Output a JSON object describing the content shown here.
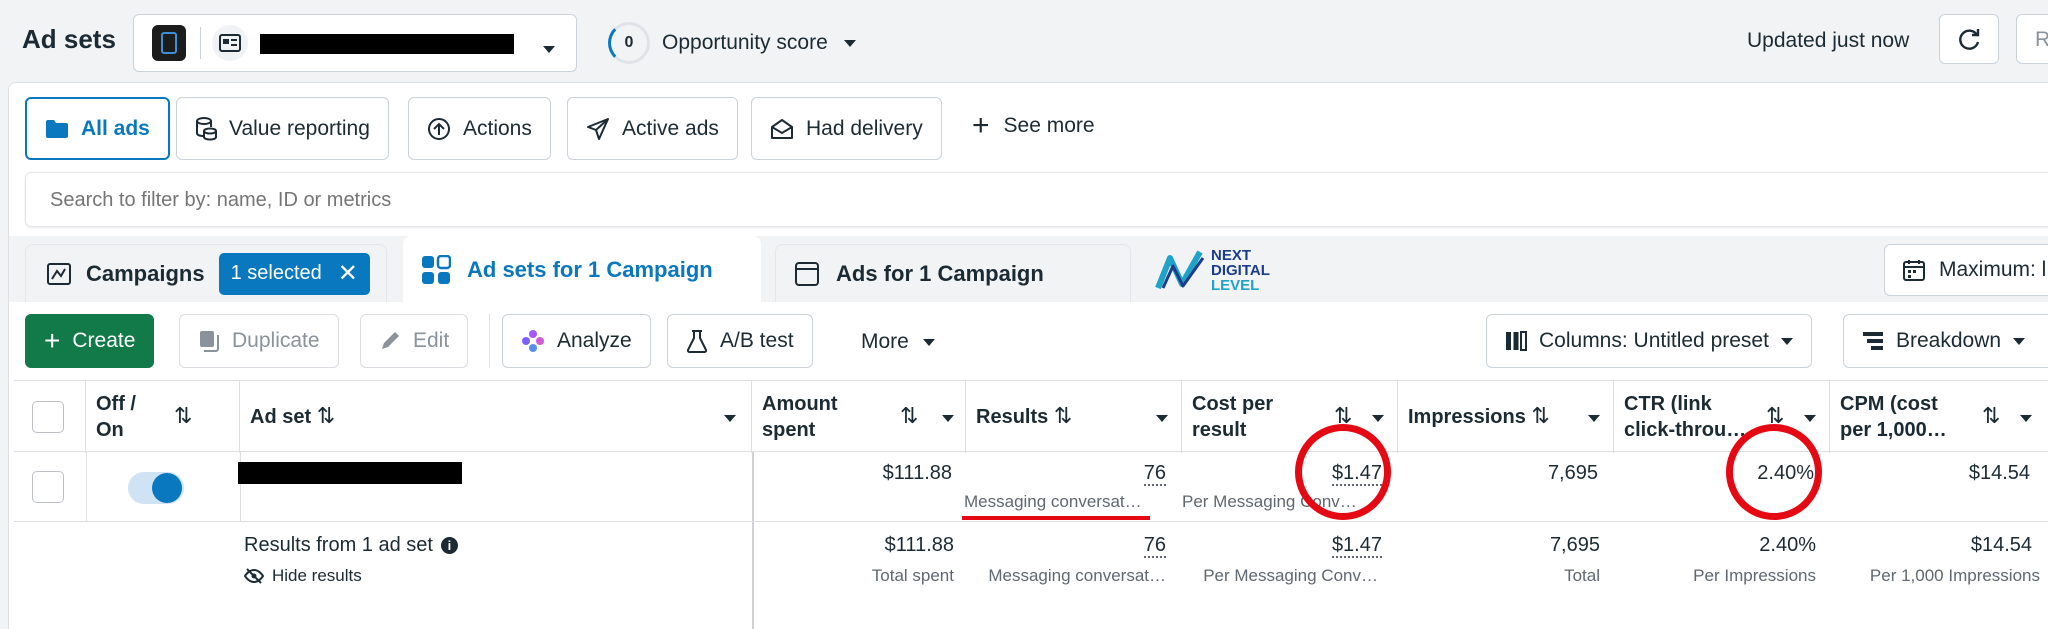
{
  "header": {
    "title": "Ad sets",
    "opportunity_score_value": "0",
    "opportunity_score_label": "Opportunity score",
    "updated_text": "Updated just now",
    "cut_button_label": "R"
  },
  "filters": {
    "all_ads": "All ads",
    "value_reporting": "Value reporting",
    "actions": "Actions",
    "active_ads": "Active ads",
    "had_delivery": "Had delivery",
    "see_more": "See more"
  },
  "search": {
    "placeholder": "Search to filter by: name, ID or metrics"
  },
  "tabs": {
    "campaigns": "Campaigns",
    "selected_badge": "1 selected",
    "ad_sets": "Ad sets for 1 Campaign",
    "ads": "Ads for 1 Campaign",
    "maximum_label": "Maximum: l"
  },
  "logo": {
    "line1": "NEXT",
    "line2": "DIGITAL",
    "line3": "LEVEL"
  },
  "toolbar": {
    "create": "Create",
    "duplicate": "Duplicate",
    "edit": "Edit",
    "analyze": "Analyze",
    "ab_test": "A/B test",
    "more": "More",
    "columns": "Columns: Untitled preset",
    "breakdown": "Breakdown"
  },
  "columns": {
    "off_on": "Off / On",
    "ad_set": "Ad set",
    "amount_spent": "Amount spent",
    "results": "Results",
    "cost_per_result": "Cost per result",
    "impressions": "Impressions",
    "ctr": "CTR (link click-throu…",
    "cpm": "CPM (cost per 1,000…"
  },
  "row": {
    "amount_spent": "$111.88",
    "results": "76",
    "results_sub": "Messaging conversat…",
    "cost_per_result": "$1.47",
    "cost_sub": "Per Messaging Conv…",
    "impressions": "7,695",
    "ctr": "2.40%",
    "cpm": "$14.54"
  },
  "summary": {
    "label": "Results from 1 ad set",
    "hide_results": "Hide results",
    "amount_spent": "$111.88",
    "amount_sub": "Total spent",
    "results": "76",
    "results_sub": "Messaging conversat…",
    "cost_per_result": "$1.47",
    "cost_sub": "Per Messaging Conv…",
    "impressions": "7,695",
    "impressions_sub": "Total",
    "ctr": "2.40%",
    "ctr_sub": "Per Impressions",
    "cpm": "$14.54",
    "cpm_sub": "Per 1,000 Impressions"
  },
  "colors": {
    "accent": "#0a78be",
    "create_green": "#127a48",
    "annotation_red": "#e50914"
  }
}
